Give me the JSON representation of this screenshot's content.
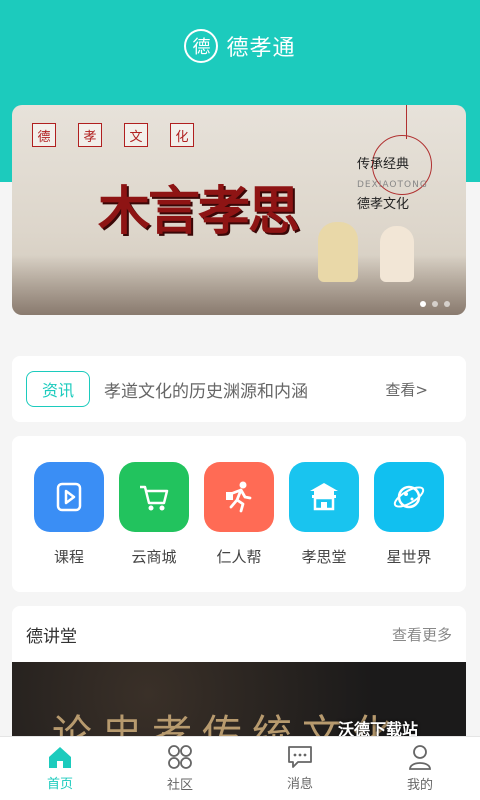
{
  "app": {
    "logo_char": "德",
    "title": "德孝通"
  },
  "banner": {
    "tags": [
      "德",
      "孝",
      "文",
      "化"
    ],
    "title": "木言孝思",
    "right_line1": "传承经典",
    "right_sub": "DEXIAOTONG",
    "right_line2": "德孝文化",
    "slide_count": 3,
    "active_slide": 1
  },
  "news": {
    "tag": "资讯",
    "text": "孝道文化的历史渊源和内涵",
    "more": "查看>"
  },
  "grid": [
    {
      "label": "课程",
      "icon": "course-icon",
      "color": "#3a8ef5"
    },
    {
      "label": "云商城",
      "icon": "cart-icon",
      "color": "#22c35e"
    },
    {
      "label": "仁人帮",
      "icon": "runner-icon",
      "color": "#ff6b55"
    },
    {
      "label": "孝思堂",
      "icon": "temple-icon",
      "color": "#19c4ef"
    },
    {
      "label": "星世界",
      "icon": "planet-icon",
      "color": "#11c0f0"
    }
  ],
  "lecture": {
    "title": "德讲堂",
    "more": "查看更多",
    "image_text": "论忠孝传统文化"
  },
  "watermark": "沃德下载站",
  "tabs": [
    {
      "label": "首页",
      "icon": "home-icon",
      "active": true
    },
    {
      "label": "社区",
      "icon": "community-icon",
      "active": false
    },
    {
      "label": "消息",
      "icon": "message-icon",
      "active": false
    },
    {
      "label": "我的",
      "icon": "profile-icon",
      "active": false
    }
  ],
  "colors": {
    "primary": "#1ccbbd"
  }
}
